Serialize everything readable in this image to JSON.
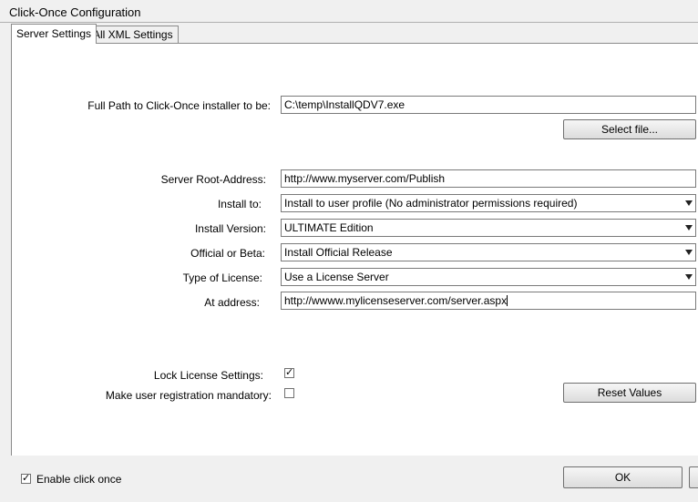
{
  "window": {
    "title": "Click-Once Configuration"
  },
  "tabs": [
    {
      "label": "Server Settings",
      "active": true
    },
    {
      "label": "All XML Settings",
      "active": false
    }
  ],
  "installer": {
    "label": "Full Path to Click-Once installer to be:",
    "value": "C:\\temp\\InstallQDV7.exe",
    "select_button": "Select file..."
  },
  "server_root": {
    "label": "Server Root-Address:",
    "value": "http://www.myserver.com/Publish"
  },
  "install_to": {
    "label": "Install to:",
    "value": "Install to user profile (No administrator permissions required)"
  },
  "install_version": {
    "label": "Install Version:",
    "value": "ULTIMATE Edition"
  },
  "official_beta": {
    "label": "Official or Beta:",
    "value": "Install Official Release"
  },
  "license_type": {
    "label": "Type of License:",
    "value": "Use a License Server"
  },
  "license_address": {
    "label": "At address:",
    "value": "http://wwww.mylicenseserver.com/server.aspx"
  },
  "lock_license": {
    "label": "Lock License Settings:",
    "checked": true
  },
  "mandatory_registration": {
    "label": "Make user registration mandatory:",
    "checked": false
  },
  "reset_button": "Reset Values",
  "enable_click_once": {
    "label": "Enable click once",
    "checked": true
  },
  "ok_button": "OK",
  "icons": {
    "checkmark": "check-mark",
    "dropdown": "chevron-down"
  }
}
